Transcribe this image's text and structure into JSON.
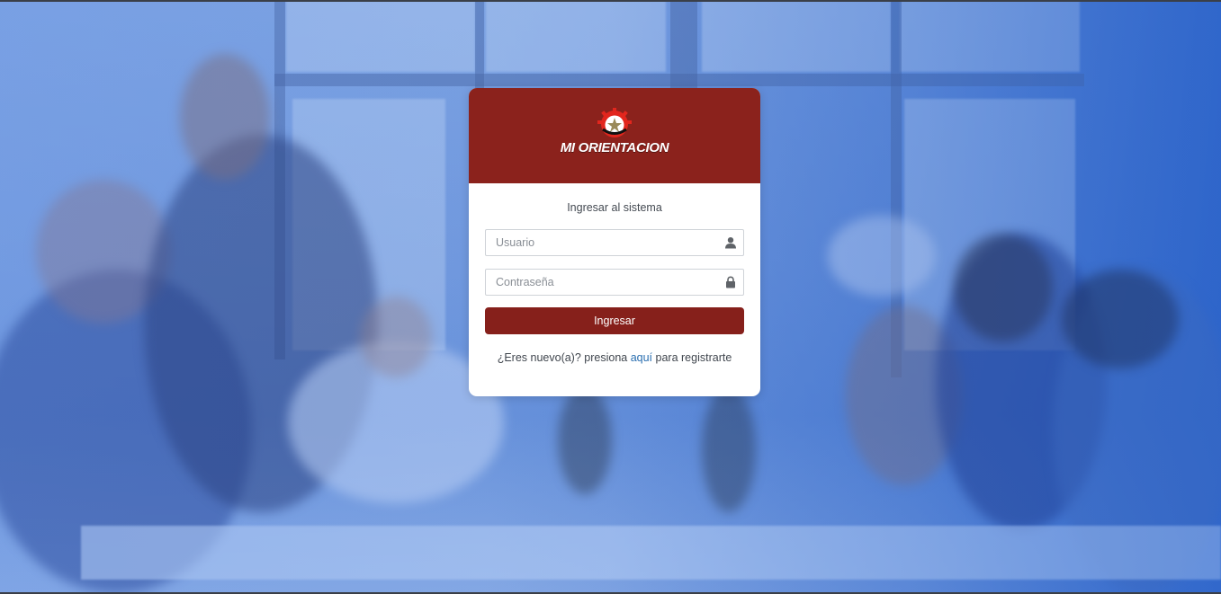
{
  "login": {
    "brand": "MI ORIENTACION",
    "title": "Ingresar al sistema",
    "username_placeholder": "Usuario",
    "password_placeholder": "Contraseña",
    "submit_label": "Ingresar",
    "register_prefix": "¿Eres nuevo(a)? presiona ",
    "register_link": "aquí",
    "register_suffix": " para registrarte"
  },
  "icons": {
    "username": "user-icon",
    "password": "lock-icon",
    "logo": "emblem-icon"
  },
  "colors": {
    "header": "#8b221c",
    "button": "#86201b",
    "link": "#2a6fb0",
    "background_tint": "#4a7fd0"
  }
}
